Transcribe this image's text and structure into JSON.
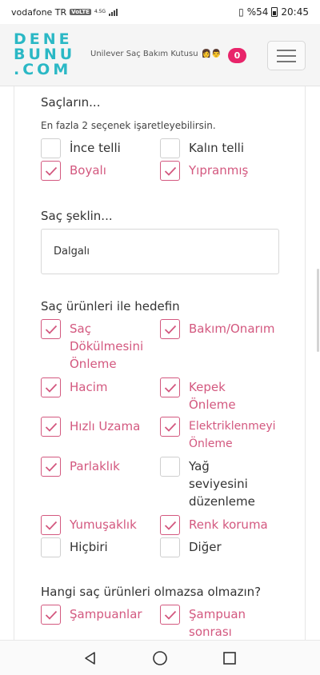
{
  "status_bar": {
    "carrier": "vodafone TR",
    "volte": "VoLTE",
    "network": "4.5G",
    "battery": "%54",
    "time": "20:45"
  },
  "header": {
    "logo_line1": "DENE",
    "logo_line2": "BUNU",
    "logo_line3": ".COM",
    "campaign_title": "Unilever Saç Bakım Kutusu",
    "emoji": "👩👨",
    "cart_count": "0",
    "brand_color": "#2bb8c5",
    "accent_color": "#e8246a"
  },
  "form": {
    "q1": {
      "title": "Saçların...",
      "hint": "En fazla 2 seçenek işaretleyebilirsin.",
      "options": [
        {
          "label": "İnce telli",
          "checked": false
        },
        {
          "label": "Kalın telli",
          "checked": false
        },
        {
          "label": "Boyalı",
          "checked": true
        },
        {
          "label": "Yıpranmış",
          "checked": true
        }
      ]
    },
    "q2": {
      "title": "Saç şeklin...",
      "selected": "Dalgalı"
    },
    "q3": {
      "title": "Saç ürünleri ile hedefin",
      "options": [
        {
          "label": "Saç Dökülmesini Önleme",
          "checked": true
        },
        {
          "label": "Bakım/Onarım",
          "checked": true
        },
        {
          "label": "Hacim",
          "checked": true
        },
        {
          "label": "Kepek Önleme",
          "checked": true
        },
        {
          "label": "Hızlı Uzama",
          "checked": true
        },
        {
          "label": "Elektriklenmeyi Önleme",
          "checked": true
        },
        {
          "label": "Parlaklık",
          "checked": true
        },
        {
          "label": "Yağ seviyesini düzenleme",
          "checked": false
        },
        {
          "label": "Yumuşaklık",
          "checked": true
        },
        {
          "label": "Renk koruma",
          "checked": true
        },
        {
          "label": "Hiçbiri",
          "checked": false
        },
        {
          "label": "Diğer",
          "checked": false
        }
      ]
    },
    "q4": {
      "title": "Hangi saç ürünleri olmazsa olmazın?",
      "options": [
        {
          "label": "Şampuanlar",
          "checked": true
        },
        {
          "label": "Şampuan sonrası",
          "checked": true
        }
      ]
    },
    "checked_color": "#d3587f"
  },
  "nav": {
    "back_icon": "back-triangle-icon",
    "home_icon": "home-circle-icon",
    "recents_icon": "recents-square-icon"
  }
}
